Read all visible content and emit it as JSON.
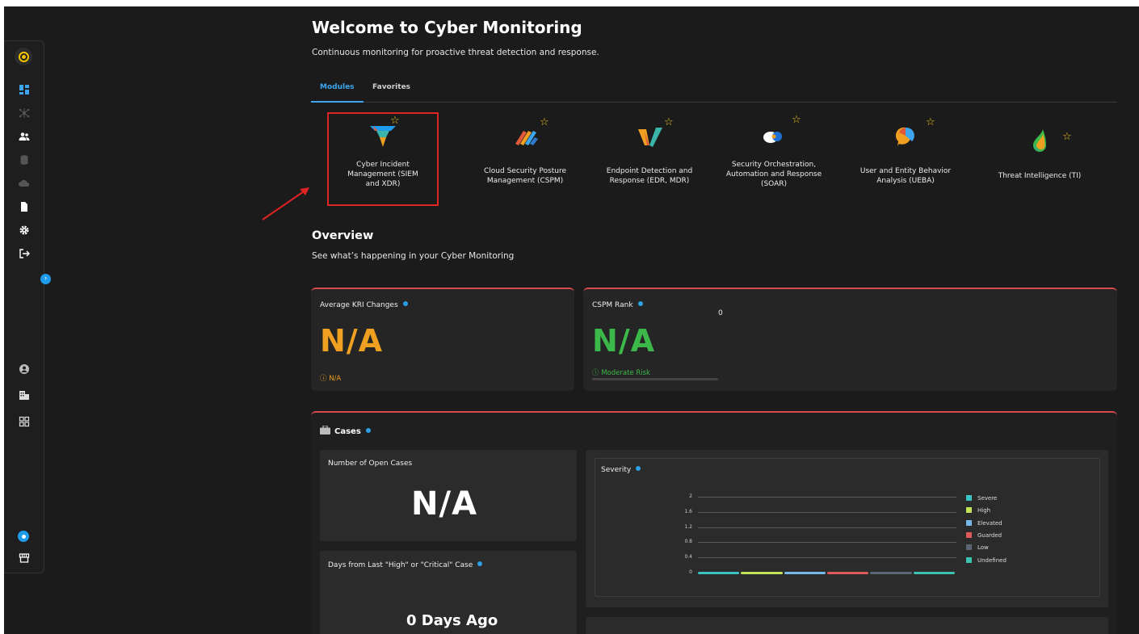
{
  "header": {
    "title": "Welcome to Cyber Monitoring",
    "subtitle": "Continuous monitoring for proactive threat detection and response."
  },
  "tabs": [
    {
      "label": "Modules",
      "active": true
    },
    {
      "label": "Favorites",
      "active": false
    }
  ],
  "modules": [
    {
      "label": "Cyber Incident Management (SIEM and XDR)",
      "icon": "siem-xdr-icon",
      "highlighted": true
    },
    {
      "label": "Cloud Security Posture Management (CSPM)",
      "icon": "cspm-icon"
    },
    {
      "label": "Endpoint Detection and Response (EDR, MDR)",
      "icon": "edr-mdr-icon"
    },
    {
      "label": "Security Orchestration, Automation and Response (SOAR)",
      "icon": "soar-icon"
    },
    {
      "label": "User and Entity Behavior Analysis (UEBA)",
      "icon": "ueba-icon"
    },
    {
      "label": "Threat Intelligence (TI)",
      "icon": "threat-intelligence-icon"
    }
  ],
  "overview": {
    "title": "Overview",
    "subtitle": "See what’s happening in your Cyber Monitoring"
  },
  "kri_card": {
    "title": "Average KRI Changes",
    "value": "N/A",
    "note": "N/A",
    "color": "#f0a020"
  },
  "cspm_card": {
    "title": "CSPM Rank",
    "value": "N/A",
    "note": "Moderate Risk",
    "zero_label": "0",
    "color": "#3cb84a"
  },
  "cases": {
    "title": "Cases",
    "open_cases": {
      "title": "Number of Open Cases",
      "value": "N/A"
    },
    "days_since": {
      "title": "Days from Last \"High\" or \"Critical\" Case",
      "value": "0 Days Ago"
    }
  },
  "chart_data": {
    "type": "line",
    "title": "Severity",
    "yticks": [
      "2",
      "1.6",
      "1.2",
      "0.8",
      "0.4",
      "0"
    ],
    "ylim": [
      0,
      2
    ],
    "legend_position": "right",
    "series": [
      {
        "name": "Severe",
        "color": "#3bc2c2",
        "values": [
          0,
          0
        ]
      },
      {
        "name": "High",
        "color": "#c3e35a",
        "values": [
          0,
          0
        ]
      },
      {
        "name": "Elevated",
        "color": "#74b9e8",
        "values": [
          0,
          0
        ]
      },
      {
        "name": "Guarded",
        "color": "#e05a5a",
        "values": [
          0,
          0
        ]
      },
      {
        "name": "Low",
        "color": "#5a6673",
        "values": [
          0,
          0
        ]
      },
      {
        "name": "Undefined",
        "color": "#3bc2b0",
        "values": [
          0,
          0
        ]
      }
    ]
  },
  "colors": {
    "accent": "#3ea6ee",
    "background": "#1b1b1b",
    "card_border": "#d74b4b",
    "highlight": "#e02323"
  },
  "sidebar": {
    "items": [
      {
        "icon": "dashboard-icon"
      },
      {
        "icon": "network-icon"
      },
      {
        "icon": "users-icon"
      },
      {
        "icon": "database-icon"
      },
      {
        "icon": "cloud-icon"
      },
      {
        "icon": "document-icon"
      },
      {
        "icon": "settings-icon"
      },
      {
        "icon": "logout-icon"
      },
      {
        "icon": "user-account-icon"
      },
      {
        "icon": "organization-icon"
      },
      {
        "icon": "apps-grid-icon"
      },
      {
        "icon": "chat-icon"
      },
      {
        "icon": "store-icon"
      }
    ]
  }
}
